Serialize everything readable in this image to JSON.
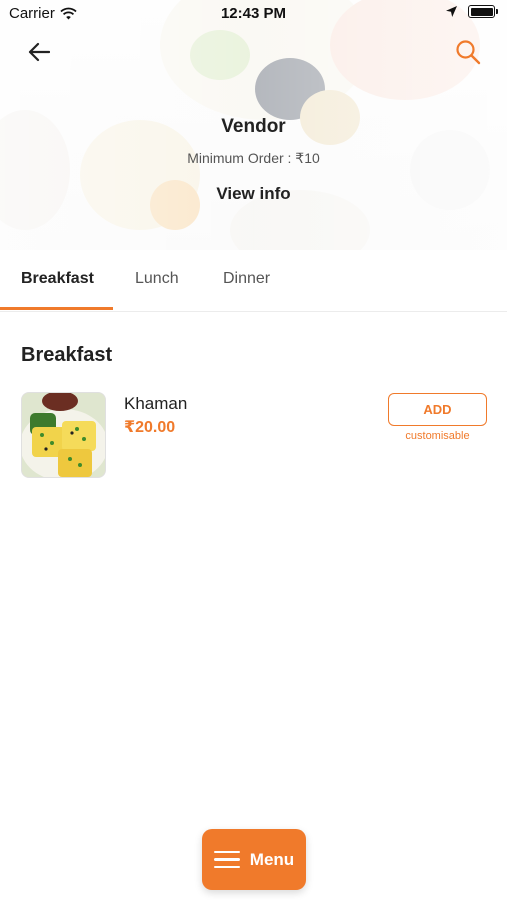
{
  "status_bar": {
    "carrier": "Carrier",
    "time": "12:43 PM",
    "icons": [
      "wifi-icon",
      "location-arrow-icon",
      "battery-icon"
    ]
  },
  "header": {
    "back_icon": "arrow-left-icon",
    "search_icon": "search-icon",
    "vendor_name": "Vendor",
    "minimum_order": "Minimum Order : ₹10",
    "view_info": "View info"
  },
  "tabs": [
    {
      "label": "Breakfast",
      "active": true
    },
    {
      "label": "Lunch",
      "active": false
    },
    {
      "label": "Dinner",
      "active": false
    }
  ],
  "section": {
    "title": "Breakfast",
    "items": [
      {
        "name": "Khaman",
        "price": "₹20.00",
        "add_label": "ADD",
        "note": "customisable"
      }
    ]
  },
  "fab": {
    "label": "Menu",
    "icon": "hamburger-menu-icon"
  },
  "colors": {
    "accent": "#f07a2b",
    "text": "#222222",
    "muted": "#555555"
  }
}
